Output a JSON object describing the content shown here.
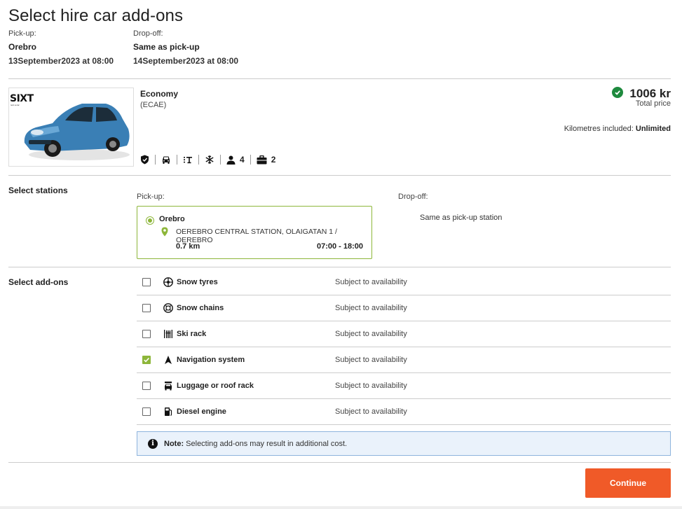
{
  "page": {
    "title": "Select hire car add-ons"
  },
  "trip": {
    "pickup_label": "Pick-up:",
    "pickup_location": "Orebro",
    "pickup_datetime": "13September2023 at 08:00",
    "dropoff_label": "Drop-off:",
    "dropoff_location": "Same as pick-up",
    "dropoff_datetime": "14September2023 at 08:00"
  },
  "car": {
    "brand": "SIXT",
    "brand_sub": "rent a car",
    "category": "Economy",
    "code": "(ECAE)",
    "price": "1006 kr",
    "price_label": "Total price",
    "km_label": "Kilometres included:",
    "km_value": "Unlimited",
    "color": "#3a7fb5",
    "features": [
      {
        "icon": "shield-icon"
      },
      {
        "icon": "car-front-icon"
      },
      {
        "icon": "transmission-icon"
      },
      {
        "icon": "snowflake-icon"
      },
      {
        "icon": "person-icon",
        "count": "4"
      },
      {
        "icon": "luggage-icon",
        "count": "2"
      }
    ]
  },
  "stations": {
    "section_label": "Select stations",
    "pickup_label": "Pick-up:",
    "dropoff_label": "Drop-off:",
    "pickup_name": "Orebro",
    "pickup_address": "OEREBRO CENTRAL STATION, OLAIGATAN 1 / OEREBRO",
    "pickup_distance": "0.7 km",
    "pickup_hours": "07:00 - 18:00",
    "dropoff_text": "Same as pick-up station",
    "accent": "#8db63a"
  },
  "addons": {
    "section_label": "Select add-ons",
    "items": [
      {
        "name": "Snow tyres",
        "availability": "Subject to availability",
        "checked": false,
        "icon": "tyre-icon"
      },
      {
        "name": "Snow chains",
        "availability": "Subject to availability",
        "checked": false,
        "icon": "snow-chain-icon"
      },
      {
        "name": "Ski rack",
        "availability": "Subject to availability",
        "checked": false,
        "icon": "ski-rack-icon"
      },
      {
        "name": "Navigation system",
        "availability": "Subject to availability",
        "checked": true,
        "icon": "navigation-arrow-icon"
      },
      {
        "name": "Luggage or roof rack",
        "availability": "Subject to availability",
        "checked": false,
        "icon": "roof-rack-icon"
      },
      {
        "name": "Diesel engine",
        "availability": "Subject to availability",
        "checked": false,
        "icon": "fuel-pump-icon"
      }
    ]
  },
  "note": {
    "bold": "Note:",
    "text": " Selecting add-ons may result in additional cost."
  },
  "actions": {
    "continue_label": "Continue",
    "continue_color": "#f05a28"
  }
}
